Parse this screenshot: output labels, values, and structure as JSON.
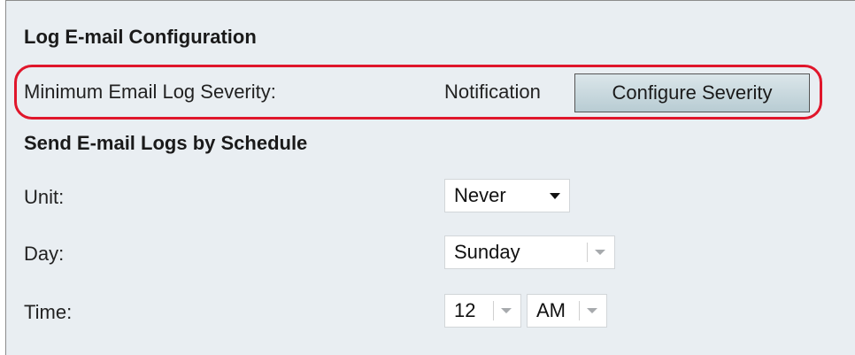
{
  "log_email": {
    "title": "Log E-mail Configuration",
    "severity_label": "Minimum Email Log Severity:",
    "severity_value": "Notification",
    "configure_button": "Configure Severity"
  },
  "schedule": {
    "title": "Send E-mail Logs by Schedule",
    "unit_label": "Unit:",
    "unit_value": "Never",
    "day_label": "Day:",
    "day_value": "Sunday",
    "time_label": "Time:",
    "hour_value": "12",
    "ampm_value": "AM"
  },
  "colors": {
    "highlight": "#e0162b",
    "panel_bg": "#e9eef2"
  },
  "icons": {
    "dropdown": "chevron-down-icon"
  }
}
